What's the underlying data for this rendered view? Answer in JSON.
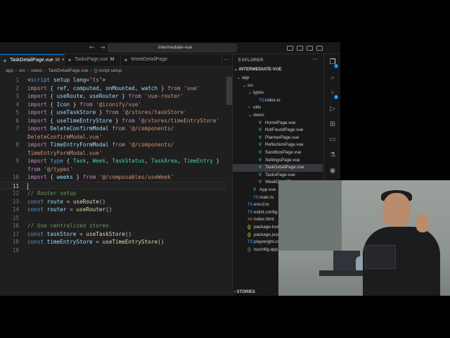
{
  "titlebar": {
    "search_text": "intermediate-vue"
  },
  "tabs": [
    {
      "label": "TaskDetailPage.vue",
      "badge": "M",
      "close": "×",
      "active": true
    },
    {
      "label": "TasksPage.vue",
      "badge": "M",
      "active": false
    },
    {
      "label": "WeekDetailPage",
      "badge": "",
      "active": false
    }
  ],
  "breadcrumb": [
    "app",
    "src",
    "views",
    "TaskDetailPage.vue",
    "{} script setup"
  ],
  "code_lines": [
    {
      "n": "1",
      "tokens": [
        [
          "p",
          "<"
        ],
        [
          "kb",
          "script"
        ],
        [
          "v",
          " setup"
        ],
        [
          "p",
          " "
        ],
        [
          "v",
          "lang"
        ],
        [
          "p",
          "="
        ],
        [
          "s",
          "\"ts\""
        ],
        [
          "p",
          ">"
        ]
      ]
    },
    {
      "n": "2",
      "tokens": [
        [
          "k",
          "import"
        ],
        [
          "p",
          " { "
        ],
        [
          "v",
          "ref"
        ],
        [
          "p",
          ", "
        ],
        [
          "v",
          "computed"
        ],
        [
          "p",
          ", "
        ],
        [
          "v",
          "onMounted"
        ],
        [
          "p",
          ", "
        ],
        [
          "v",
          "watch"
        ],
        [
          "p",
          " } "
        ],
        [
          "k",
          "from"
        ],
        [
          "s",
          " 'vue'"
        ]
      ]
    },
    {
      "n": "3",
      "tokens": [
        [
          "k",
          "import"
        ],
        [
          "p",
          " { "
        ],
        [
          "v",
          "useRoute"
        ],
        [
          "p",
          ", "
        ],
        [
          "v",
          "useRouter"
        ],
        [
          "p",
          " } "
        ],
        [
          "k",
          "from"
        ],
        [
          "s",
          " 'vue-router'"
        ]
      ]
    },
    {
      "n": "4",
      "tokens": [
        [
          "k",
          "import"
        ],
        [
          "p",
          " { "
        ],
        [
          "v",
          "Icon"
        ],
        [
          "p",
          " } "
        ],
        [
          "k",
          "from"
        ],
        [
          "s",
          " '@iconify/vue'"
        ]
      ]
    },
    {
      "n": "5",
      "tokens": [
        [
          "k",
          "import"
        ],
        [
          "p",
          " { "
        ],
        [
          "v",
          "useTaskStore"
        ],
        [
          "p",
          " } "
        ],
        [
          "k",
          "from"
        ],
        [
          "s",
          " '@/stores/taskStore'"
        ]
      ]
    },
    {
      "n": "6",
      "tokens": [
        [
          "k",
          "import"
        ],
        [
          "p",
          " { "
        ],
        [
          "v",
          "useTimeEntryStore"
        ],
        [
          "p",
          " } "
        ],
        [
          "k",
          "from"
        ],
        [
          "s",
          " '@/stores/timeEntryStore'"
        ]
      ]
    },
    {
      "n": "7",
      "tokens": [
        [
          "k",
          "import"
        ],
        [
          "v",
          " DeleteConfirmModal"
        ],
        [
          "k",
          " from"
        ],
        [
          "s",
          " '@/components/"
        ]
      ]
    },
    {
      "n": "",
      "tokens": [
        [
          "s",
          "DeleteConfirmModal.vue'"
        ]
      ]
    },
    {
      "n": "8",
      "tokens": [
        [
          "k",
          "import"
        ],
        [
          "v",
          " TimeEntryFormModal"
        ],
        [
          "k",
          " from"
        ],
        [
          "s",
          " '@/components/"
        ]
      ]
    },
    {
      "n": "",
      "tokens": [
        [
          "s",
          "TimeEntryFormModal.vue'"
        ]
      ]
    },
    {
      "n": "9",
      "tokens": [
        [
          "k",
          "import"
        ],
        [
          "kb",
          " type"
        ],
        [
          "p",
          " { "
        ],
        [
          "t",
          "Task"
        ],
        [
          "p",
          ", "
        ],
        [
          "t",
          "Week"
        ],
        [
          "p",
          ", "
        ],
        [
          "t",
          "TaskStatus"
        ],
        [
          "p",
          ", "
        ],
        [
          "t",
          "TaskArea"
        ],
        [
          "p",
          ", "
        ],
        [
          "t",
          "TimeEntry"
        ],
        [
          "p",
          " }"
        ]
      ]
    },
    {
      "n": "",
      "tokens": [
        [
          "k",
          "from"
        ],
        [
          "s",
          " '@/types'"
        ]
      ]
    },
    {
      "n": "10",
      "tokens": [
        [
          "k",
          "import"
        ],
        [
          "p",
          " { "
        ],
        [
          "v",
          "weeks"
        ],
        [
          "p",
          " } "
        ],
        [
          "k",
          "from"
        ],
        [
          "s",
          " '@/composables/useWeek'"
        ]
      ]
    },
    {
      "n": "11",
      "tokens": [],
      "cursor": true
    },
    {
      "n": "12",
      "tokens": [
        [
          "c",
          "// Router setup"
        ]
      ]
    },
    {
      "n": "13",
      "tokens": [
        [
          "kb",
          "const"
        ],
        [
          "v",
          " route"
        ],
        [
          "p",
          " = "
        ],
        [
          "f",
          "useRoute"
        ],
        [
          "p",
          "()"
        ]
      ]
    },
    {
      "n": "14",
      "tokens": [
        [
          "kb",
          "const"
        ],
        [
          "v",
          " router"
        ],
        [
          "p",
          " = "
        ],
        [
          "f",
          "useRouter"
        ],
        [
          "p",
          "()"
        ]
      ]
    },
    {
      "n": "15",
      "tokens": []
    },
    {
      "n": "16",
      "tokens": [
        [
          "c",
          "// Use centralized stores"
        ]
      ]
    },
    {
      "n": "17",
      "tokens": [
        [
          "kb",
          "const"
        ],
        [
          "v",
          " taskStore"
        ],
        [
          "p",
          " = "
        ],
        [
          "f",
          "useTaskStore"
        ],
        [
          "p",
          "()"
        ]
      ]
    },
    {
      "n": "18",
      "tokens": [
        [
          "kb",
          "const"
        ],
        [
          "v",
          " timeEntryStore"
        ],
        [
          "p",
          " = "
        ],
        [
          "f",
          "useTimeEntryStore"
        ],
        [
          "p",
          "()"
        ]
      ]
    },
    {
      "n": "19",
      "tokens": []
    }
  ],
  "explorer": {
    "header": "EXPLORER",
    "more": "···",
    "project": "INTERMEDIATE-VUE",
    "stories": "STORIES",
    "tree": [
      {
        "label": "app",
        "depth": 0,
        "chev": "⌄",
        "icon": ""
      },
      {
        "label": "src",
        "depth": 1,
        "chev": "⌄",
        "icon": ""
      },
      {
        "label": "types",
        "depth": 2,
        "chev": "⌄",
        "icon": ""
      },
      {
        "label": "index.ts",
        "depth": 3,
        "chev": "",
        "icon": "TS",
        "kind": "ts"
      },
      {
        "label": "utils",
        "depth": 2,
        "chev": "›",
        "icon": ""
      },
      {
        "label": "views",
        "depth": 2,
        "chev": "⌄",
        "icon": ""
      },
      {
        "label": "HomePage.vue",
        "depth": 3,
        "chev": "",
        "icon": "V",
        "kind": "vue"
      },
      {
        "label": "NotFoundPage.vue",
        "depth": 3,
        "chev": "",
        "icon": "V",
        "kind": "vue"
      },
      {
        "label": "PlannerPage.vue",
        "depth": 3,
        "chev": "",
        "icon": "V",
        "kind": "vue"
      },
      {
        "label": "ReflectionPage.vue",
        "depth": 3,
        "chev": "",
        "icon": "V",
        "kind": "vue"
      },
      {
        "label": "SandboxPage.vue",
        "depth": 3,
        "chev": "",
        "icon": "V",
        "kind": "vue"
      },
      {
        "label": "SettingsPage.vue",
        "depth": 3,
        "chev": "",
        "icon": "V",
        "kind": "vue"
      },
      {
        "label": "TaskDetailPage.vue",
        "depth": 3,
        "chev": "",
        "icon": "V",
        "kind": "vue",
        "selected": true
      },
      {
        "label": "TasksPage.vue",
        "depth": 3,
        "chev": "",
        "icon": "V",
        "kind": "vue"
      },
      {
        "label": "WeekDetailPage.vue",
        "depth": 3,
        "chev": "",
        "icon": "V",
        "kind": "vue"
      },
      {
        "label": "App.vue",
        "depth": 2,
        "chev": "",
        "icon": "V",
        "kind": "vue"
      },
      {
        "label": "main.ts",
        "depth": 2,
        "chev": "",
        "icon": "TS",
        "kind": "ts"
      },
      {
        "label": "env.d.ts",
        "depth": 1,
        "chev": "",
        "icon": "TS",
        "kind": "ts"
      },
      {
        "label": "eslint.config.ts",
        "depth": 1,
        "chev": "",
        "icon": "TS",
        "kind": "ts"
      },
      {
        "label": "index.html",
        "depth": 1,
        "chev": "",
        "icon": "<>",
        "kind": "html"
      },
      {
        "label": "package-lock.json",
        "depth": 1,
        "chev": "",
        "icon": "{}",
        "kind": "json"
      },
      {
        "label": "package.json",
        "depth": 1,
        "chev": "",
        "icon": "{}",
        "kind": "json"
      },
      {
        "label": "playwright.config.ts",
        "depth": 1,
        "chev": "",
        "icon": "TS",
        "kind": "ts"
      },
      {
        "label": "tsconfig.app.json",
        "depth": 1,
        "chev": "",
        "icon": "{}",
        "kind": "cfg"
      }
    ]
  },
  "activity_bar": [
    {
      "name": "files-icon",
      "glyph": "❐",
      "active": true,
      "badge": "1"
    },
    {
      "name": "search-icon",
      "glyph": "⌕",
      "active": false
    },
    {
      "name": "source-control-icon",
      "glyph": "⑂",
      "active": false,
      "badge": "8"
    },
    {
      "name": "run-debug-icon",
      "glyph": "▷",
      "active": false
    },
    {
      "name": "extensions-icon",
      "glyph": "⊞",
      "active": false
    },
    {
      "name": "remote-icon",
      "glyph": "▭",
      "active": false
    },
    {
      "name": "testing-icon",
      "glyph": "⚗",
      "active": false
    },
    {
      "name": "github-icon",
      "glyph": "◉",
      "active": false
    },
    {
      "name": "docker-icon",
      "glyph": "◈",
      "active": false
    },
    {
      "name": "account-icon",
      "glyph": "◯",
      "active": false
    },
    {
      "name": "settings-icon",
      "glyph": "⚙",
      "active": false
    }
  ],
  "colors": {
    "editor_bg": "#1f1f1f",
    "sidebar_bg": "#181818",
    "accent": "#0078d4",
    "vue_green": "#41b883"
  }
}
